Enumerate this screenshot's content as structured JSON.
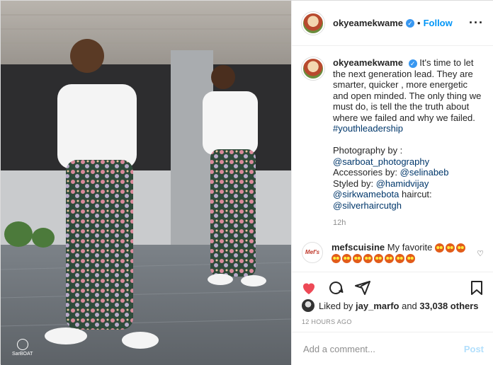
{
  "colors": {
    "accent": "#0095f6",
    "verified": "#3897f0",
    "like_red": "#ed4956",
    "muted": "#8e8e8e",
    "post_disabled": "#b2dffc"
  },
  "photo": {
    "description_icon": "photo-image",
    "watermark": "SarBOAT"
  },
  "header": {
    "username": "okyeamekwame",
    "separator": "•",
    "follow_label": "Follow",
    "more_icon": "more-horizontal-icon"
  },
  "caption": {
    "username": "okyeamekwame",
    "text": "It's time to let the next generation lead. They are smarter, quicker , more energetic and open minded. The only thing we must do, is tell the the truth about where we failed and why we failed.",
    "hashtag": "#youthleadership",
    "credit_line1": "Photography by :",
    "credit_mention1": "@sarboat_photography",
    "credit_line2": "Accessories by: ",
    "credit_mention2": "@selinabeb",
    "credit_line3": "Styled by: ",
    "credit_mention3": "@hamidvijay",
    "credit_mention4": "@sirkwamebota",
    "credit_line4": " haircut:",
    "credit_mention5": "@silverhaircutgh",
    "time": "12h"
  },
  "comment": {
    "avatar_text": "Mef's",
    "username": "mefscuisine",
    "text": "My favorite"
  },
  "actions": {
    "like_icon": "heart-filled-icon",
    "comment_icon": "comment-icon",
    "share_icon": "share-icon",
    "save_icon": "bookmark-icon"
  },
  "likes": {
    "prefix": "Liked by ",
    "user": "jay_marfo",
    "middle": " and ",
    "count": "33,038 others"
  },
  "posted_ago": "12 HOURS AGO",
  "add_comment": {
    "placeholder": "Add a comment...",
    "post_label": "Post"
  }
}
